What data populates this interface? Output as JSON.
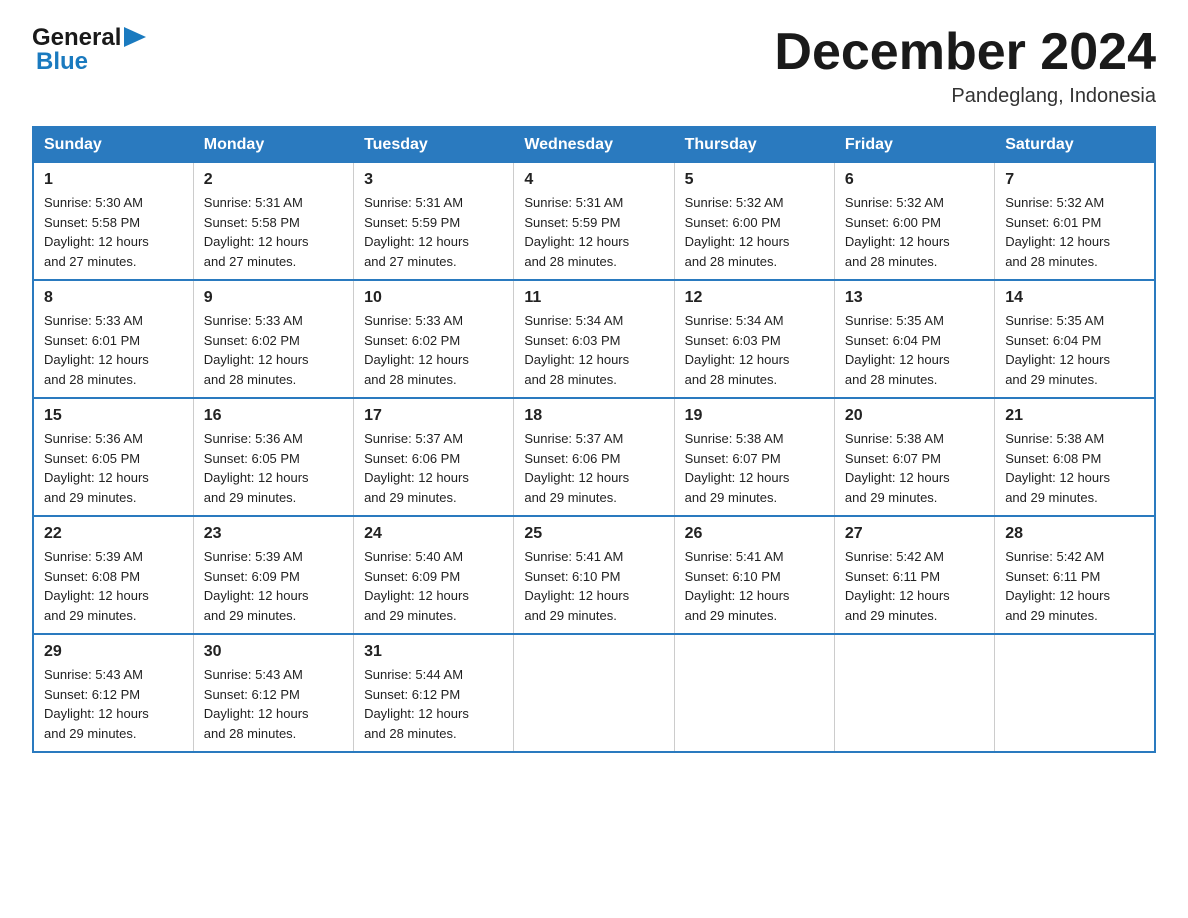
{
  "header": {
    "logo_general": "General",
    "logo_blue": "Blue",
    "month_title": "December 2024",
    "location": "Pandeglang, Indonesia"
  },
  "days_of_week": [
    "Sunday",
    "Monday",
    "Tuesday",
    "Wednesday",
    "Thursday",
    "Friday",
    "Saturday"
  ],
  "weeks": [
    [
      {
        "day": "1",
        "sunrise": "5:30 AM",
        "sunset": "5:58 PM",
        "daylight": "12 hours and 27 minutes."
      },
      {
        "day": "2",
        "sunrise": "5:31 AM",
        "sunset": "5:58 PM",
        "daylight": "12 hours and 27 minutes."
      },
      {
        "day": "3",
        "sunrise": "5:31 AM",
        "sunset": "5:59 PM",
        "daylight": "12 hours and 27 minutes."
      },
      {
        "day": "4",
        "sunrise": "5:31 AM",
        "sunset": "5:59 PM",
        "daylight": "12 hours and 28 minutes."
      },
      {
        "day": "5",
        "sunrise": "5:32 AM",
        "sunset": "6:00 PM",
        "daylight": "12 hours and 28 minutes."
      },
      {
        "day": "6",
        "sunrise": "5:32 AM",
        "sunset": "6:00 PM",
        "daylight": "12 hours and 28 minutes."
      },
      {
        "day": "7",
        "sunrise": "5:32 AM",
        "sunset": "6:01 PM",
        "daylight": "12 hours and 28 minutes."
      }
    ],
    [
      {
        "day": "8",
        "sunrise": "5:33 AM",
        "sunset": "6:01 PM",
        "daylight": "12 hours and 28 minutes."
      },
      {
        "day": "9",
        "sunrise": "5:33 AM",
        "sunset": "6:02 PM",
        "daylight": "12 hours and 28 minutes."
      },
      {
        "day": "10",
        "sunrise": "5:33 AM",
        "sunset": "6:02 PM",
        "daylight": "12 hours and 28 minutes."
      },
      {
        "day": "11",
        "sunrise": "5:34 AM",
        "sunset": "6:03 PM",
        "daylight": "12 hours and 28 minutes."
      },
      {
        "day": "12",
        "sunrise": "5:34 AM",
        "sunset": "6:03 PM",
        "daylight": "12 hours and 28 minutes."
      },
      {
        "day": "13",
        "sunrise": "5:35 AM",
        "sunset": "6:04 PM",
        "daylight": "12 hours and 28 minutes."
      },
      {
        "day": "14",
        "sunrise": "5:35 AM",
        "sunset": "6:04 PM",
        "daylight": "12 hours and 29 minutes."
      }
    ],
    [
      {
        "day": "15",
        "sunrise": "5:36 AM",
        "sunset": "6:05 PM",
        "daylight": "12 hours and 29 minutes."
      },
      {
        "day": "16",
        "sunrise": "5:36 AM",
        "sunset": "6:05 PM",
        "daylight": "12 hours and 29 minutes."
      },
      {
        "day": "17",
        "sunrise": "5:37 AM",
        "sunset": "6:06 PM",
        "daylight": "12 hours and 29 minutes."
      },
      {
        "day": "18",
        "sunrise": "5:37 AM",
        "sunset": "6:06 PM",
        "daylight": "12 hours and 29 minutes."
      },
      {
        "day": "19",
        "sunrise": "5:38 AM",
        "sunset": "6:07 PM",
        "daylight": "12 hours and 29 minutes."
      },
      {
        "day": "20",
        "sunrise": "5:38 AM",
        "sunset": "6:07 PM",
        "daylight": "12 hours and 29 minutes."
      },
      {
        "day": "21",
        "sunrise": "5:38 AM",
        "sunset": "6:08 PM",
        "daylight": "12 hours and 29 minutes."
      }
    ],
    [
      {
        "day": "22",
        "sunrise": "5:39 AM",
        "sunset": "6:08 PM",
        "daylight": "12 hours and 29 minutes."
      },
      {
        "day": "23",
        "sunrise": "5:39 AM",
        "sunset": "6:09 PM",
        "daylight": "12 hours and 29 minutes."
      },
      {
        "day": "24",
        "sunrise": "5:40 AM",
        "sunset": "6:09 PM",
        "daylight": "12 hours and 29 minutes."
      },
      {
        "day": "25",
        "sunrise": "5:41 AM",
        "sunset": "6:10 PM",
        "daylight": "12 hours and 29 minutes."
      },
      {
        "day": "26",
        "sunrise": "5:41 AM",
        "sunset": "6:10 PM",
        "daylight": "12 hours and 29 minutes."
      },
      {
        "day": "27",
        "sunrise": "5:42 AM",
        "sunset": "6:11 PM",
        "daylight": "12 hours and 29 minutes."
      },
      {
        "day": "28",
        "sunrise": "5:42 AM",
        "sunset": "6:11 PM",
        "daylight": "12 hours and 29 minutes."
      }
    ],
    [
      {
        "day": "29",
        "sunrise": "5:43 AM",
        "sunset": "6:12 PM",
        "daylight": "12 hours and 29 minutes."
      },
      {
        "day": "30",
        "sunrise": "5:43 AM",
        "sunset": "6:12 PM",
        "daylight": "12 hours and 28 minutes."
      },
      {
        "day": "31",
        "sunrise": "5:44 AM",
        "sunset": "6:12 PM",
        "daylight": "12 hours and 28 minutes."
      },
      null,
      null,
      null,
      null
    ]
  ],
  "labels": {
    "sunrise": "Sunrise:",
    "sunset": "Sunset:",
    "daylight": "Daylight:"
  }
}
